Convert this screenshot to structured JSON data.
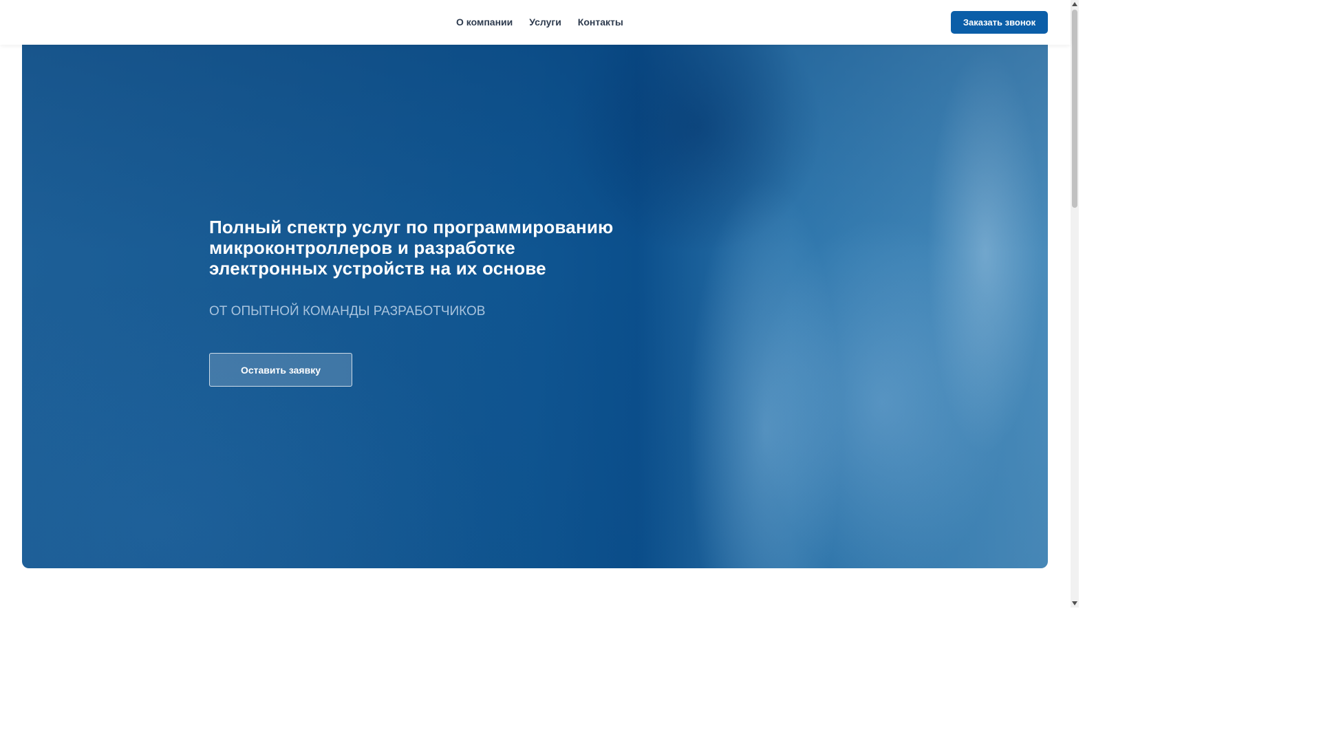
{
  "header": {
    "nav": [
      {
        "label": "О компании"
      },
      {
        "label": "Услуги"
      },
      {
        "label": "Контакты"
      }
    ],
    "callback_button": "Заказать звонок"
  },
  "hero": {
    "title_lines": [
      "Полный спектр услуг по программированию",
      "микроконтроллеров и разработке",
      "электронных устройств на их основе"
    ],
    "subtitle": "ОТ ОПЫТНОЙ КОМАНДЫ РАЗРАБОТЧИКОВ",
    "cta_button": "Оставить заявку"
  },
  "icons": {
    "scroll_up": "triangle-up-icon",
    "scroll_down": "triangle-down-icon"
  },
  "colors": {
    "accent": "#0b5ea8",
    "subtitle": "#a9c4de"
  }
}
